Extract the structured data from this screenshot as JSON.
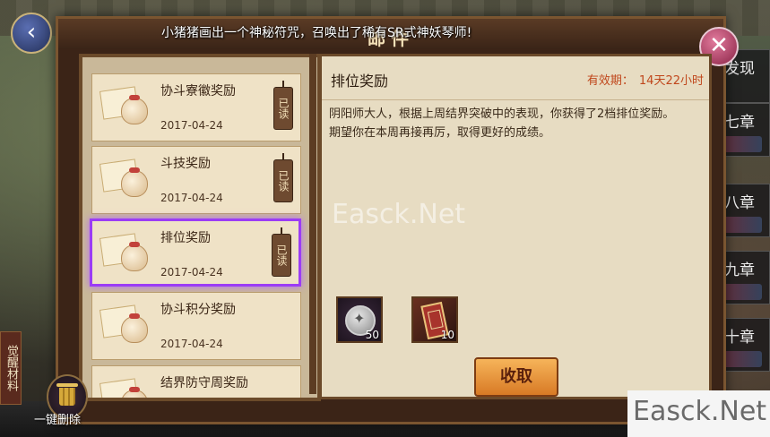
{
  "window": {
    "title": "邮件",
    "marquee": "小猪猪画出一个神秘符咒，召唤出了稀有SR式神妖琴师!"
  },
  "side_labels": {
    "awaken_material": "觉醒材料",
    "chapters": [
      "发现",
      "七章",
      "八章",
      "九章",
      "十章"
    ]
  },
  "mail_list": [
    {
      "title": "协斗寮徽奖励",
      "date": "2017-04-24",
      "read_tag": "已读"
    },
    {
      "title": "斗技奖励",
      "date": "2017-04-24",
      "read_tag": "已读"
    },
    {
      "title": "排位奖励",
      "date": "2017-04-24",
      "read_tag": "已读"
    },
    {
      "title": "协斗积分奖励",
      "date": "2017-04-24",
      "read_tag": ""
    },
    {
      "title": "结界防守周奖励",
      "date": "",
      "read_tag": ""
    }
  ],
  "detail": {
    "title": "排位奖励",
    "validity_label": "有效期：",
    "validity_value": "14天22小时",
    "body_line1": "阴阳师大人，根据上周结界突破中的表现，你获得了2档排位奖励。",
    "body_line2": "期望你在本周再接再厉，取得更好的成绩。",
    "rewards": [
      {
        "icon": "coin-icon",
        "quantity": "50"
      },
      {
        "icon": "ticket-icon",
        "quantity": "10"
      }
    ],
    "claim_button": "收取"
  },
  "bottom": {
    "delete_all": "一键删除"
  },
  "watermarks": {
    "center": "Easck.Net",
    "corner": "Easck.Net"
  },
  "colors": {
    "selected_border": "#9b3cf5",
    "validity_text": "#c0471c",
    "claim_button": "#f6b45a"
  }
}
